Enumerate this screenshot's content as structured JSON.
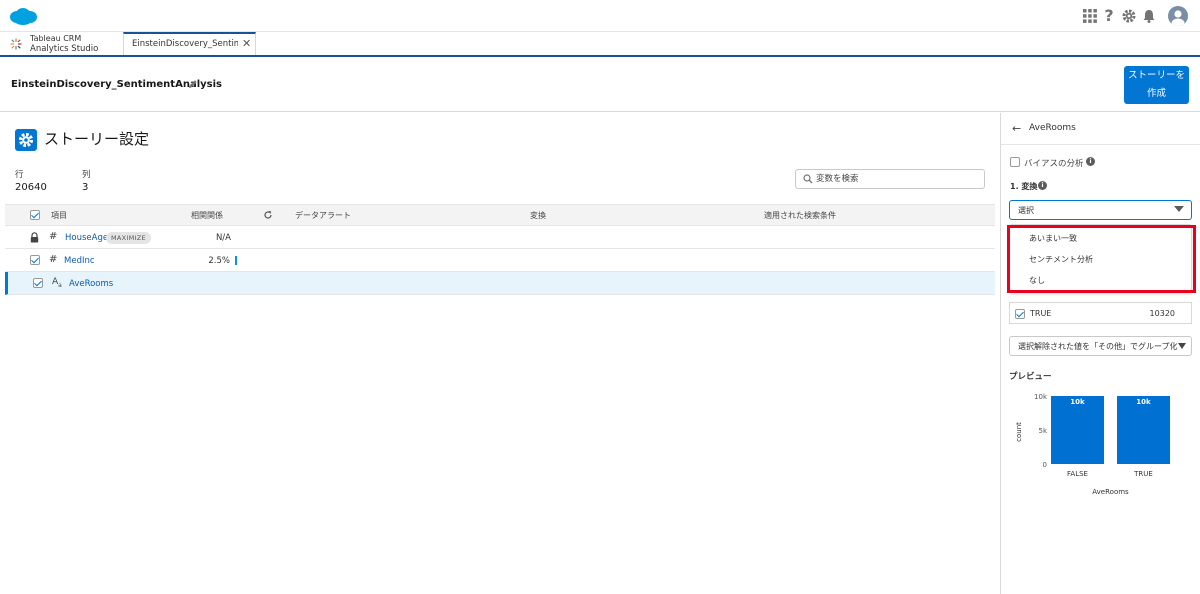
{
  "tab_bar": {
    "app_line1": "Tableau CRM",
    "app_line2": "Analytics Studio",
    "active_tab": "EinsteinDiscovery_Sentimen...",
    "close_glyph": "✕"
  },
  "page_header": {
    "story_title": "EinsteinDiscovery_SentimentAnalysis",
    "create_story_label": "ストーリーを作成"
  },
  "main": {
    "title": "ストーリー設定",
    "rows_label": "行",
    "rows_value": "20640",
    "cols_label": "列",
    "cols_value": "3",
    "search_placeholder": "変数を検索",
    "table": {
      "headers": [
        "項目",
        "相関関係",
        "データアラート",
        "変換",
        "適用された検索条件"
      ],
      "rows": [
        {
          "name": "HouseAge",
          "type_icon": "lock",
          "badge": "MAXIMIZE",
          "correlation": "N/A",
          "checked": false,
          "selected": false
        },
        {
          "name": "MedInc",
          "type_icon": "#",
          "badge": "",
          "correlation": "2.5%",
          "checked": true,
          "selected": false
        },
        {
          "name": "AveRooms",
          "type_icon": "Aa",
          "badge": "",
          "correlation": "",
          "checked": true,
          "selected": true
        }
      ]
    }
  },
  "right_panel": {
    "title": "AveRooms",
    "bias_label": "バイアスの分析",
    "transform_label": "1. 変換",
    "transform_value": "選択",
    "dropdown_options": [
      "あいまい一致",
      "センチメント分析",
      "なし"
    ],
    "true_label": "TRUE",
    "true_count": "10320",
    "group_value": "選択解除された値を「その他」でグループ化",
    "preview_label": "プレビュー"
  },
  "colors": {
    "brand_blue": "#0176d3",
    "highlight_red": "#e8001c",
    "bar_blue": "#0070d2"
  },
  "chart_data": {
    "type": "bar",
    "categories": [
      "FALSE",
      "TRUE"
    ],
    "values": [
      10320,
      10320
    ],
    "data_labels": [
      "10k",
      "10k"
    ],
    "yticks": [
      "10k",
      "5k",
      "0"
    ],
    "ylim": [
      0,
      10320
    ],
    "ylabel": "count",
    "xlabel": "AveRooms",
    "grid": false,
    "legend": "none"
  }
}
